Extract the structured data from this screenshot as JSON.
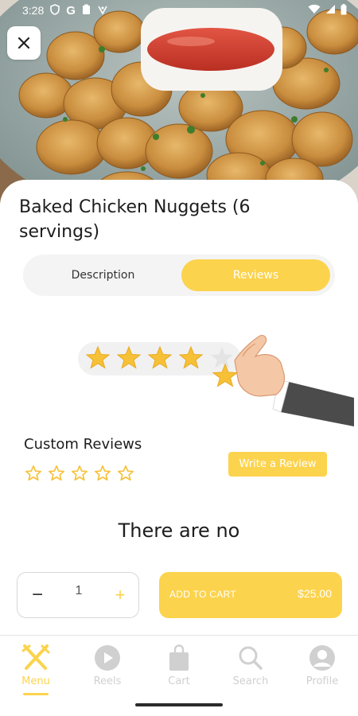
{
  "status_bar": {
    "time": "3:28",
    "left_icons": [
      "shield-icon",
      "google-g-icon",
      "clipboard-icon",
      "chevron-badge-icon"
    ],
    "right_icons": [
      "wifi-icon",
      "signal-icon",
      "battery-icon"
    ]
  },
  "product": {
    "title": "Baked Chicken Nuggets (6 servings)",
    "image": "chicken-nuggets-with-ketchup-photo"
  },
  "tabs": [
    {
      "label": "Description",
      "selected": false
    },
    {
      "label": "Reviews",
      "selected": true
    }
  ],
  "illustration": {
    "name": "hand-placing-star-rating",
    "stars_filled": 4,
    "stars_total": 5
  },
  "reviews": {
    "section_label": "Custom Reviews",
    "rating": 0,
    "rating_max": 5,
    "write_button": "Write a Review",
    "empty_message": "There are no"
  },
  "quantity": {
    "value": "1",
    "minus": "−",
    "plus": "+"
  },
  "cart": {
    "label": "ADD TO CART",
    "price": "$25.00"
  },
  "nav": {
    "items": [
      {
        "label": "Menu",
        "icon": "fork-knife-icon",
        "active": true
      },
      {
        "label": "Reels",
        "icon": "play-circle-icon",
        "active": false
      },
      {
        "label": "Cart",
        "icon": "shopping-bag-icon",
        "active": false
      },
      {
        "label": "Search",
        "icon": "search-icon",
        "active": false
      },
      {
        "label": "Profile",
        "icon": "user-circle-icon",
        "active": false
      }
    ]
  },
  "colors": {
    "accent": "#fcd34d",
    "text": "#1d1d1d",
    "muted": "#d0d0d0"
  }
}
